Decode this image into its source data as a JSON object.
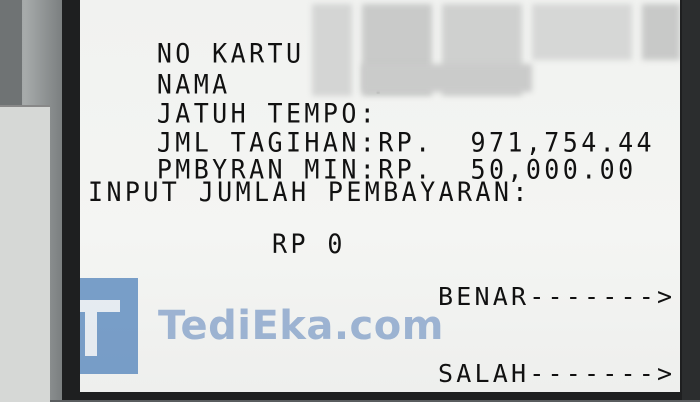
{
  "fields": [
    {
      "label": "NO KARTU",
      "colon": ":",
      "value": ""
    },
    {
      "label": "NAMA",
      "colon": ":",
      "value": ""
    },
    {
      "label": "JATUH TEMPO",
      "colon": ":",
      "value": ""
    },
    {
      "label": "JML TAGIHAN",
      "colon": ":",
      "value": "RP.  971,754.44"
    },
    {
      "label": "PMBYRAN MIN",
      "colon": ":",
      "value": "RP.  50,000.00"
    }
  ],
  "prompt": "INPUT JUMLAH PEMBAYARAN:",
  "amount": "RP 0",
  "options": {
    "correct": "BENAR------->",
    "wrong": "SALAH------->"
  },
  "watermark": {
    "text": "TediEka.com",
    "logo_letter_icon": "t-letter-logo",
    "color": "#2f6bb0"
  },
  "colors": {
    "screen_background": "#f2f3f1",
    "text": "#111111"
  }
}
